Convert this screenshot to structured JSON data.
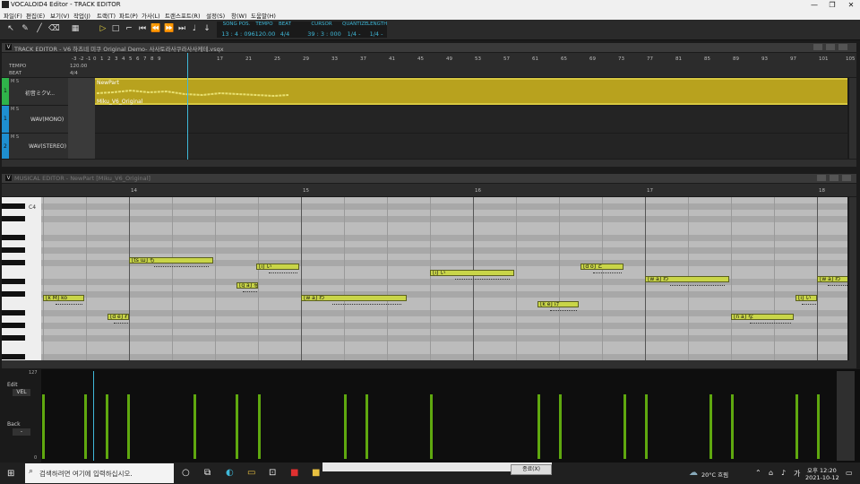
{
  "window": {
    "title": "VOCALOID4 Editor - TRACK EDITOR",
    "controls": [
      "—",
      "❐",
      "✕"
    ]
  },
  "menu": [
    "파일(F)",
    "편집(E)",
    "보기(V)",
    "작업(J)",
    "트랙(T)",
    "파트(P)",
    "가사(L)",
    "트랜스포트(R)",
    "설정(S)",
    "창(W)",
    "도움말(H)"
  ],
  "toolbar": {
    "song_pos_label": "SONG POS.",
    "song_pos": "13 : 4 : 096",
    "tempo_label": "TEMPO",
    "tempo": "120.00",
    "beat_label": "BEAT",
    "beat": "4/4",
    "cursor_label": "CURSOR",
    "cursor": "39 : 3 : 000",
    "quantize_label": "QUANTIZE",
    "quantize": "1/4 -",
    "length_label": "LENGTH",
    "length": "1/4 -"
  },
  "track_editor": {
    "title": "TRACK EDITOR - V6 하츠네 미쿠 Original Demo- 사사토라사쿠라사사케테.vsqx",
    "tempo_label": "TEMPO",
    "tempo_value": "120.00",
    "beat_label": "BEAT",
    "beat_value": "4/4",
    "ruler": [
      "-3",
      "-2",
      "-1",
      "0",
      "1",
      "2",
      "3",
      "4",
      "5",
      "6",
      "7",
      "8",
      "9",
      "17",
      "21",
      "25",
      "29",
      "33",
      "37",
      "41",
      "45",
      "49",
      "53",
      "57",
      "61",
      "65",
      "69",
      "73",
      "77",
      "81",
      "85",
      "89",
      "93",
      "97",
      "101",
      "105"
    ],
    "tracks": [
      {
        "num": "1",
        "flags": "M S",
        "name": "初音ミクV...",
        "color": "#2fb34a"
      },
      {
        "num": "1",
        "flags": "M S",
        "name": "WAV(MONO)",
        "color": "#1e8fd0"
      },
      {
        "num": "2",
        "flags": "M S",
        "name": "WAV(STEREO)",
        "color": "#1e8fd0"
      }
    ],
    "part": {
      "name": "NewPart",
      "singer": "Miku_V6_Original"
    }
  },
  "musical_editor": {
    "title": "MUSICAL EDITOR - NewPart [Miku_V6_Original]",
    "ruler": [
      "14",
      "15",
      "16",
      "17",
      "18"
    ],
    "key_label": "C4",
    "notes": [
      {
        "lyric": "[k M]",
        "phon": "ko",
        "lane": 17
      },
      {
        "lyric": "[d e]",
        "phon": "れ",
        "lane": 20
      },
      {
        "lyric": "[ts ɯ]",
        "phon": "も",
        "lane": 11
      },
      {
        "lyric": "[g a]",
        "phon": "を",
        "lane": 15
      },
      {
        "lyric": "[i]",
        "phon": "い",
        "lane": 12
      },
      {
        "lyric": "[w a]",
        "phon": "わ",
        "lane": 17
      },
      {
        "lyric": "[i]",
        "phon": "い",
        "lane": 13
      },
      {
        "lyric": "[k e]",
        "phon": "け",
        "lane": 18
      },
      {
        "lyric": "[d o]",
        "phon": "ど",
        "lane": 12
      },
      {
        "lyric": "[w a]",
        "phon": "わ",
        "lane": 14
      },
      {
        "lyric": "[n a]",
        "phon": "な",
        "lane": 20
      },
      {
        "lyric": "[i]",
        "phon": "い",
        "lane": 17
      },
      {
        "lyric": "[w a]",
        "phon": "わ",
        "lane": 14
      }
    ]
  },
  "control_pane": {
    "scale_top": "127",
    "scale_bottom": "0",
    "edit_label": "Edit",
    "edit_value": "VEL",
    "back_label": "Back",
    "back_value": "-",
    "velocities": [
      100,
      100,
      100,
      100,
      100,
      100,
      100,
      100,
      100,
      100,
      100,
      100,
      100,
      100,
      100,
      100,
      100,
      100,
      100,
      100
    ]
  },
  "taskbar": {
    "search_placeholder": "검색하려면 여기에 입력하십시오.",
    "weather": "20°C 흐림",
    "time": "오후 12:20",
    "date": "2021-10-12",
    "popup_button": "종료(X)"
  },
  "colors": {
    "accent": "#3fb8d8",
    "note": "#c9d548",
    "part": "#b8a21e",
    "velocity": "#5fa80f"
  }
}
